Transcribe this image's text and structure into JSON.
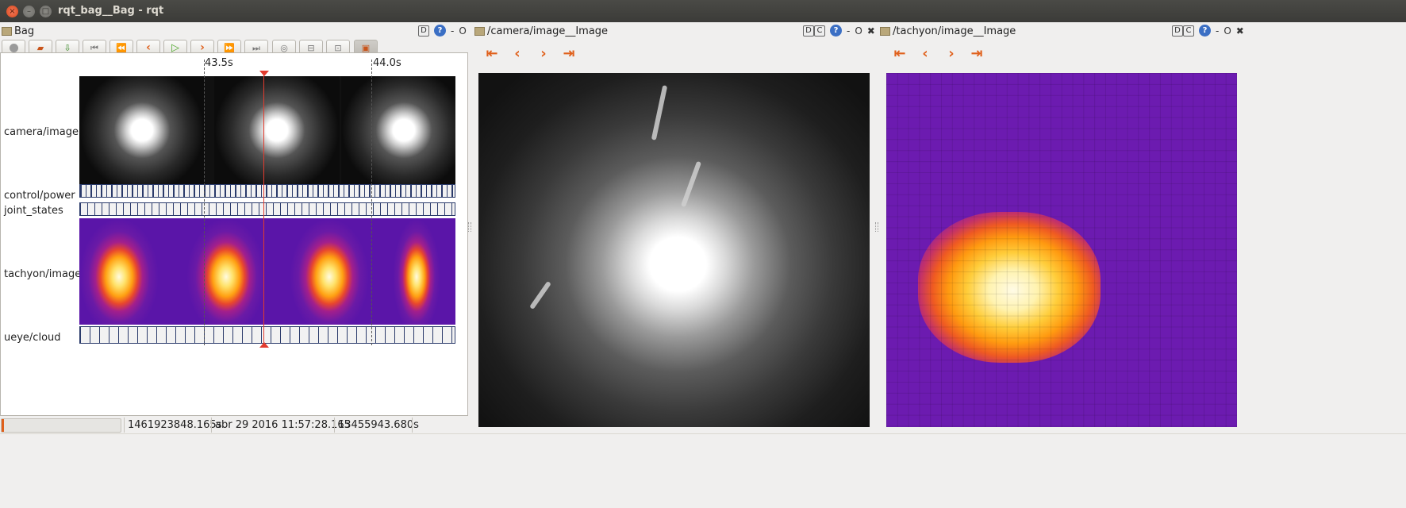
{
  "window": {
    "title": "rqt_bag__Bag - rqt"
  },
  "docks": {
    "bag": {
      "title": "Bag",
      "controls": [
        "D",
        "?",
        "-",
        "O"
      ]
    },
    "camera": {
      "title": "/camera/image__Image",
      "controls": [
        "D",
        "C",
        "?",
        "-",
        "O",
        "✖"
      ]
    },
    "tachyon": {
      "title": "/tachyon/image__Image",
      "controls": [
        "D",
        "C",
        "?",
        "-",
        "O",
        "✖"
      ]
    }
  },
  "toolbar": {
    "icons": [
      "record-icon",
      "open-icon",
      "save-icon",
      "begin-icon",
      "rewind-icon",
      "prev-icon",
      "play-icon",
      "next-icon",
      "fast-forward-icon",
      "end-icon",
      "zoom-reset-icon",
      "zoom-out-icon",
      "zoom-in-icon",
      "thumbnails-icon"
    ]
  },
  "timeline": {
    "ticks": [
      "43.5s",
      "44.0s"
    ],
    "topics": [
      "camera/image",
      "control/power",
      "joint_states",
      "tachyon/image",
      "ueye/cloud"
    ]
  },
  "status": {
    "progress": 0.02,
    "time": "1461923848.165s",
    "date": "abr 29 2016 11:57:28.165",
    "elapsed": "13455943.680s"
  },
  "colors": {
    "accent": "#e0601b",
    "cursor": "#e23b2e",
    "message_tick": "#2b3b6b",
    "thermal_bg": "#6c1bb0"
  }
}
